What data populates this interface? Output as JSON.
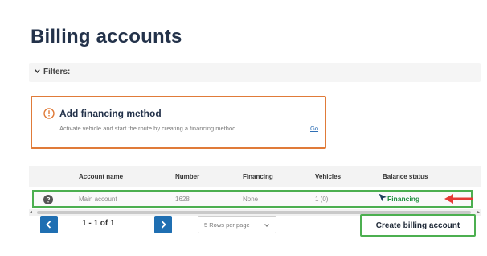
{
  "page": {
    "title": "Billing accounts"
  },
  "filters": {
    "label": "Filters:"
  },
  "alert": {
    "title": "Add financing method",
    "description": "Activate vehicle and start the route by creating a financing method",
    "link": "Go",
    "accent_color": "#e07b39"
  },
  "table": {
    "headers": [
      "Account name",
      "Number",
      "Financing",
      "Vehicles",
      "Balance status"
    ],
    "rows": [
      {
        "account_name": "Main account",
        "number": "1628",
        "financing": "None",
        "vehicles": "1 (0)",
        "balance_status": "Financing"
      }
    ],
    "highlight_color": "#4caf50"
  },
  "pagination": {
    "count": "1 - 1 of 1",
    "rows_per_page": "5 Rows per page",
    "prev_icon": "chevron-left-icon",
    "next_icon": "chevron-right-icon"
  },
  "actions": {
    "create_label": "Create billing account"
  },
  "annotations": {
    "arrow_color": "#e53935"
  }
}
